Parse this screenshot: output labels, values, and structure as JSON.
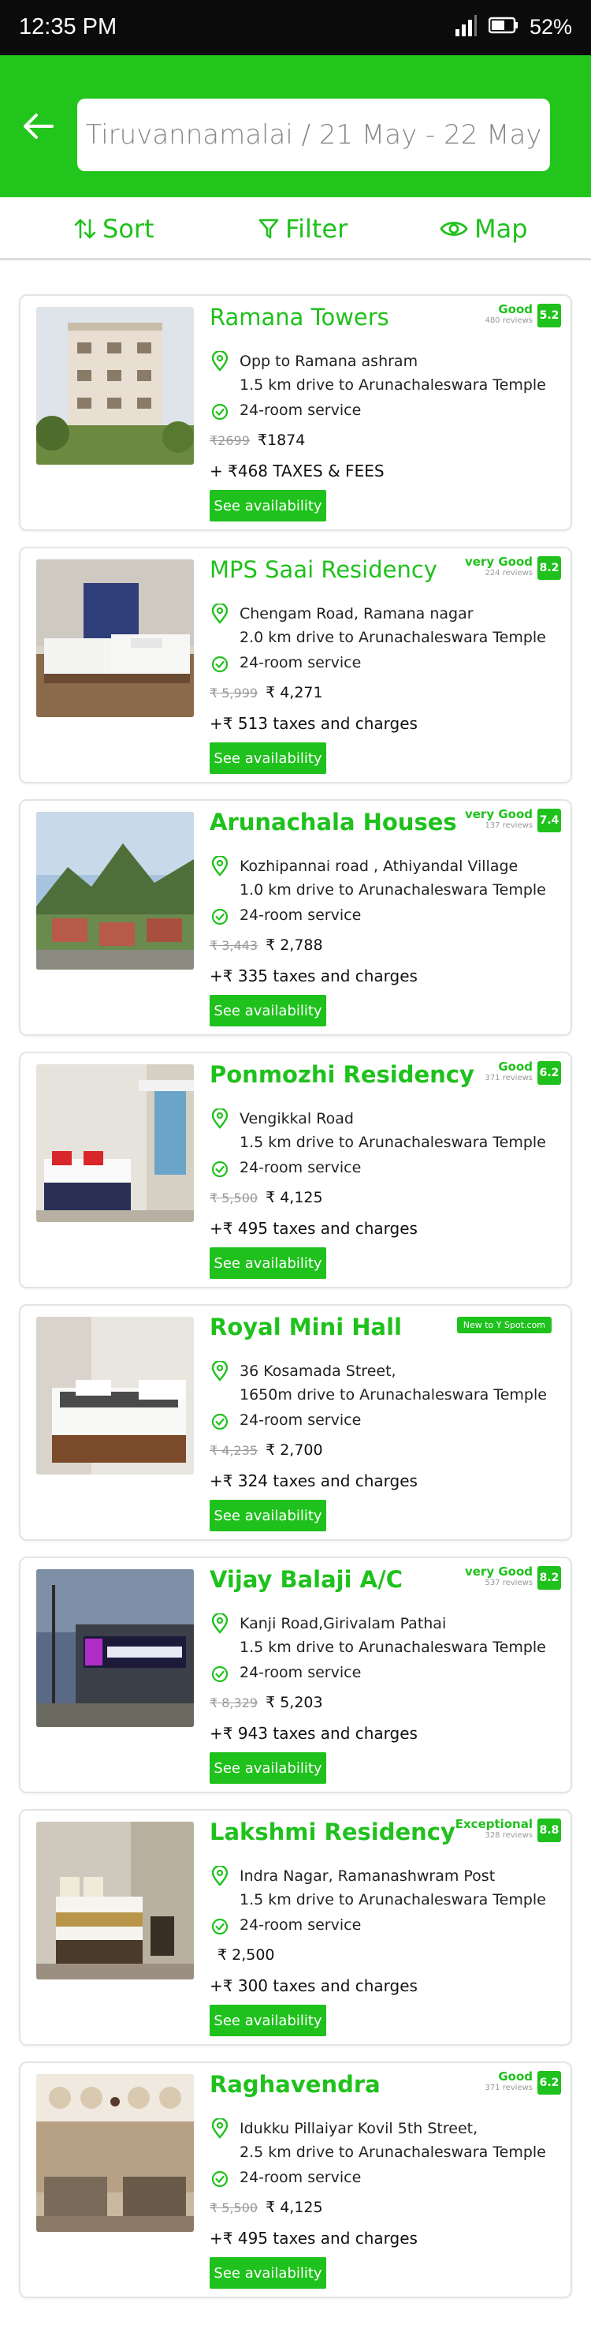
{
  "status_bar": {
    "time": "12:35 PM",
    "battery": "52%"
  },
  "search": {
    "query": "Tiruvannamalai / 21 May - 22 May"
  },
  "actions": {
    "sort": "Sort",
    "filter": "Filter",
    "map": "Map"
  },
  "colors": {
    "brand_green": "#22c51c",
    "status_bar": "#0b0b0b"
  },
  "hotels": [
    {
      "name": "Ramana Towers",
      "rating_label": "Good",
      "reviews": "480 reviews",
      "score": "5.2",
      "address_line1": "Opp to Ramana ashram",
      "address_line2": "1.5 km drive to Arunachaleswara Temple",
      "service": "24-room service",
      "old_price": "₹2699",
      "new_price": "₹1874",
      "taxes": "+ ₹468 TAXES & FEES",
      "button": "See availability"
    },
    {
      "name": "MPS Saai Residency",
      "rating_label": "very Good",
      "reviews": "224 reviews",
      "score": "8.2",
      "address_line1": "Chengam Road, Ramana nagar",
      "address_line2": "2.0 km drive to Arunachaleswara Temple",
      "service": "24-room service",
      "old_price": "₹ 5,999",
      "new_price": "₹ 4,271",
      "taxes": "+₹ 513 taxes and charges",
      "button": "See availability"
    },
    {
      "name": "Arunachala Houses",
      "rating_label": "very Good",
      "reviews": "137 reviews",
      "score": "7.4",
      "address_line1": "Kozhipannai road , Athiyandal Village",
      "address_line2": "1.0 km drive to Arunachaleswara Temple",
      "service": "24-room service",
      "old_price": "₹ 3,443",
      "new_price": "₹ 2,788",
      "taxes": "+₹ 335 taxes and charges",
      "button": "See availability"
    },
    {
      "name": "Ponmozhi  Residency",
      "rating_label": "Good",
      "reviews": "371 reviews",
      "score": "6.2",
      "address_line1": "Vengikkal Road",
      "address_line2": "1.5 km drive to Arunachaleswara Temple",
      "service": "24-room service",
      "old_price": "₹ 5,500",
      "new_price": "₹ 4,125",
      "taxes": "+₹ 495 taxes and charges",
      "button": "See availability"
    },
    {
      "name": "Royal Mini Hall",
      "badge": "New to Y Spot.com",
      "address_line1": "36 Kosamada Street,",
      "address_line2": "1650m drive to Arunachaleswara Temple",
      "service": "24-room service",
      "old_price": "₹ 4,235",
      "new_price": "₹ 2,700",
      "taxes": "+₹ 324 taxes and charges",
      "button": "See availability"
    },
    {
      "name": "Vijay Balaji A/C",
      "rating_label": "very Good",
      "reviews": "537 reviews",
      "score": "8.2",
      "address_line1": "Kanji Road,Girivalam Pathai",
      "address_line2": "1.5 km drive to Arunachaleswara Temple",
      "service": "24-room service",
      "old_price": "₹ 8,329",
      "new_price": "₹ 5,203",
      "taxes": "+₹ 943 taxes and charges",
      "button": "See availability"
    },
    {
      "name": "Lakshmi Residency",
      "rating_label": "Exceptional",
      "reviews": "328 reviews",
      "score": "8.8",
      "address_line1": "Indra Nagar, Ramanashwram Post",
      "address_line2": "1.5 km drive to Arunachaleswara Temple",
      "service": "24-room service",
      "old_price": "",
      "new_price": "₹ 2,500",
      "taxes": "+₹ 300 taxes and charges",
      "button": "See availability"
    },
    {
      "name": "Raghavendra",
      "rating_label": "Good",
      "reviews": "371 reviews",
      "score": "6.2",
      "address_line1": "Idukku Pillaiyar Kovil 5th Street,",
      "address_line2": "2.5 km drive to Arunachaleswara Temple",
      "service": "24-room service",
      "old_price": "₹ 5,500",
      "new_price": "₹ 4,125",
      "taxes": "+₹ 495 taxes and charges",
      "button": "See availability"
    }
  ]
}
